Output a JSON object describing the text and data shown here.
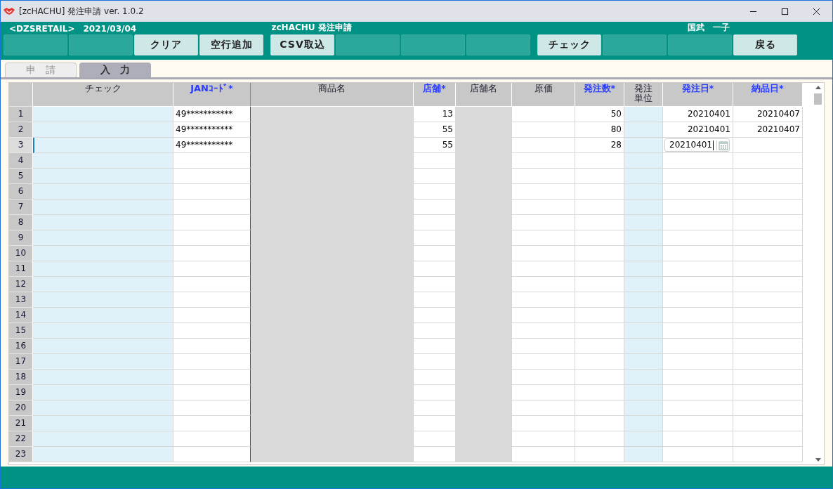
{
  "window": {
    "title": "[zcHACHU] 発注申請 ver. 1.0.2"
  },
  "header": {
    "company": "<DZSRETAIL>",
    "date": "2021/03/04",
    "app_title": "zcHACHU  発注申請",
    "user": "国武　一子"
  },
  "button_groups": [
    [
      {
        "enabled": false
      },
      {
        "enabled": false
      },
      {
        "label": "クリア",
        "enabled": true
      },
      {
        "label": "空行追加",
        "enabled": true
      }
    ],
    [
      {
        "label": "CSV取込",
        "enabled": true
      },
      {
        "enabled": false
      },
      {
        "enabled": false
      },
      {
        "enabled": false
      }
    ],
    [
      {
        "label": "チェック",
        "enabled": true
      },
      {
        "enabled": false
      },
      {
        "enabled": false
      },
      {
        "label": "戻る",
        "enabled": true
      }
    ]
  ],
  "tabs": [
    {
      "label": "申　請",
      "selected": false
    },
    {
      "label": "入　力",
      "selected": true
    }
  ],
  "table": {
    "columns": [
      {
        "label": "チェック",
        "required": false,
        "kind": "input"
      },
      {
        "label": "JANｺｰﾄﾞ*",
        "required": true,
        "kind": "plain"
      },
      {
        "label": "商品名",
        "required": false,
        "kind": "readonly"
      },
      {
        "label": "店舗*",
        "required": true,
        "kind": "plain"
      },
      {
        "label": "店舗名",
        "required": false,
        "kind": "readonly"
      },
      {
        "label": "原価",
        "required": false,
        "kind": "plain"
      },
      {
        "label": "発注数*",
        "required": true,
        "kind": "plain"
      },
      {
        "label": "発注単位",
        "required": false,
        "kind": "input"
      },
      {
        "label": "発注日*",
        "required": true,
        "kind": "plain"
      },
      {
        "label": "納品日*",
        "required": true,
        "kind": "plain"
      }
    ],
    "rows": [
      {
        "no": "1",
        "selected": false,
        "jan": "49***********",
        "store": "13",
        "qty": "50",
        "order_date": "20210401",
        "delivery_date": "20210407"
      },
      {
        "no": "2",
        "selected": false,
        "jan": "49***********",
        "store": "55",
        "qty": "80",
        "order_date": "20210401",
        "delivery_date": "20210407"
      },
      {
        "no": "3",
        "selected": true,
        "jan": "49***********",
        "store": "55",
        "qty": "28",
        "order_date": "20210401",
        "order_date_editing": true
      },
      {
        "no": "4",
        "selected": false
      },
      {
        "no": "5",
        "selected": false
      },
      {
        "no": "6",
        "selected": false
      },
      {
        "no": "7",
        "selected": false
      },
      {
        "no": "8",
        "selected": false
      },
      {
        "no": "9",
        "selected": false
      },
      {
        "no": "10",
        "selected": false
      },
      {
        "no": "11",
        "selected": false
      },
      {
        "no": "12",
        "selected": false
      },
      {
        "no": "13",
        "selected": false
      },
      {
        "no": "14",
        "selected": false
      },
      {
        "no": "15",
        "selected": false
      },
      {
        "no": "16",
        "selected": false
      },
      {
        "no": "17",
        "selected": false
      },
      {
        "no": "18",
        "selected": false
      },
      {
        "no": "19",
        "selected": false
      },
      {
        "no": "20",
        "selected": false
      },
      {
        "no": "21",
        "selected": false
      },
      {
        "no": "22",
        "selected": false
      },
      {
        "no": "23",
        "selected": false
      }
    ]
  }
}
